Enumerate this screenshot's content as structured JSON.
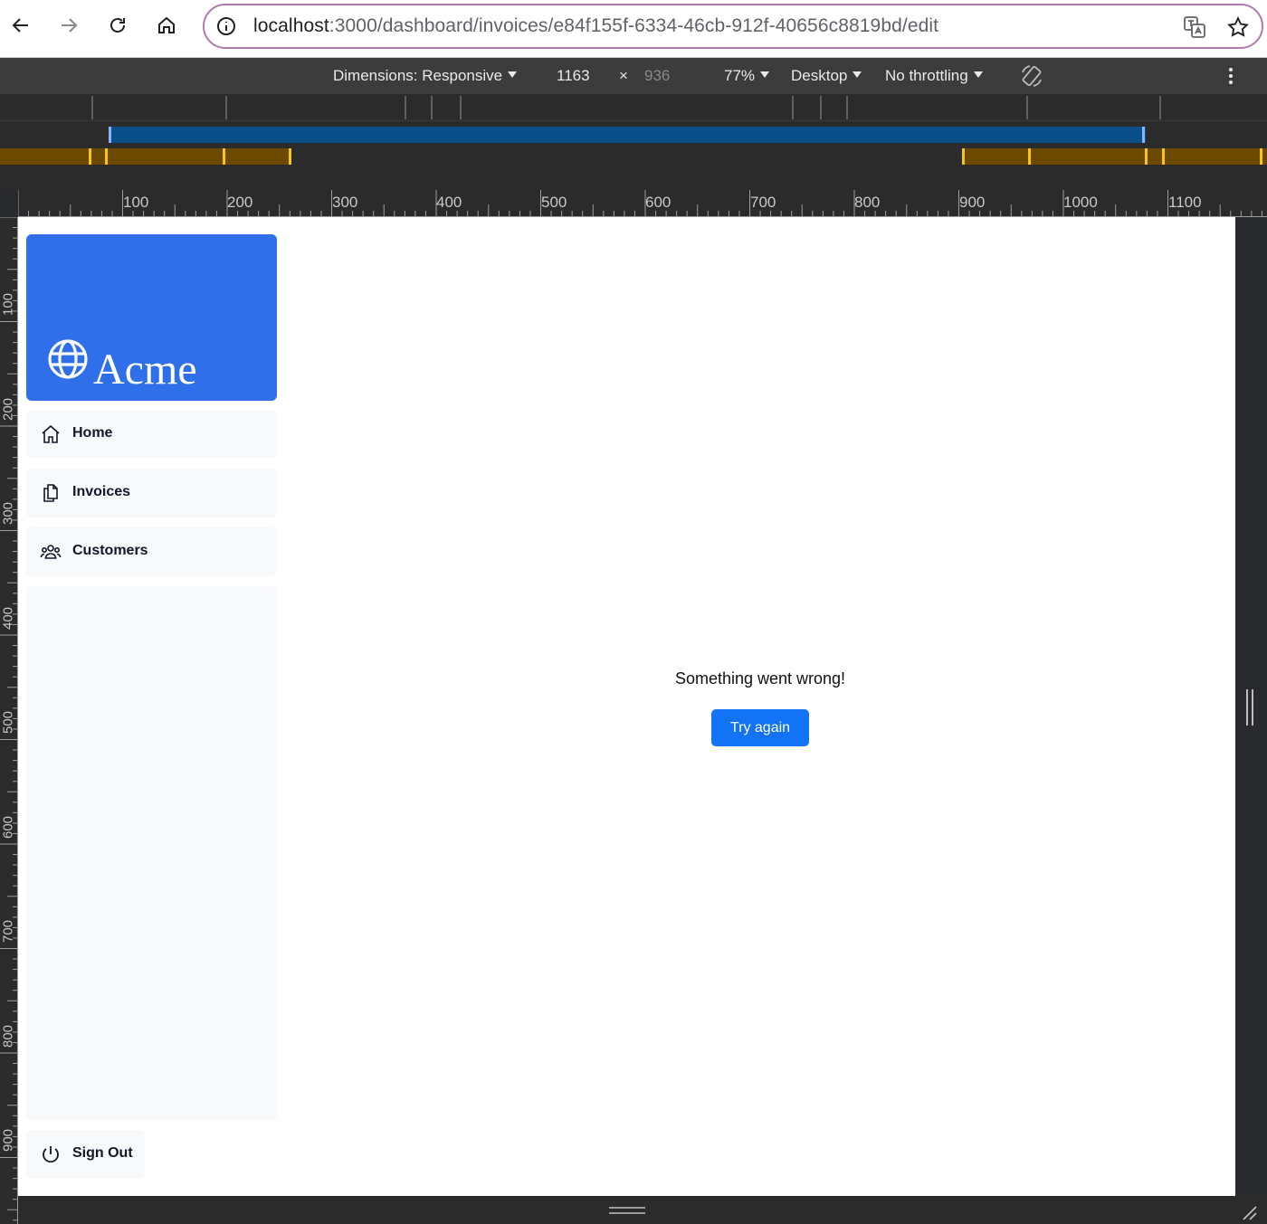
{
  "browser": {
    "url_host": "localhost",
    "url_rest": ":3000/dashboard/invoices/e84f155f-6334-46cb-912f-40656c8819bd/edit"
  },
  "device_toolbar": {
    "dimensions_label": "Dimensions: Responsive",
    "width": "1163",
    "times": "×",
    "height": "936",
    "zoom": "77%",
    "device": "Desktop",
    "throttling": "No throttling"
  },
  "rulers": {
    "top": [
      "100",
      "200",
      "300",
      "400",
      "500",
      "600",
      "700",
      "800",
      "900",
      "1000",
      "1100"
    ],
    "left": [
      "100",
      "200",
      "300",
      "400",
      "500",
      "600",
      "700",
      "800",
      "900"
    ]
  },
  "app": {
    "logo_text": "Acme",
    "nav": [
      {
        "label": "Home",
        "icon": "home-icon"
      },
      {
        "label": "Invoices",
        "icon": "documents-icon"
      },
      {
        "label": "Customers",
        "icon": "users-icon"
      }
    ],
    "signout_label": "Sign Out",
    "error_message": "Something went wrong!",
    "retry_label": "Try again",
    "colors": {
      "brand_blue": "#2f6fea",
      "button_blue": "#1273f5",
      "nav_bg": "#f8f9fb"
    }
  }
}
